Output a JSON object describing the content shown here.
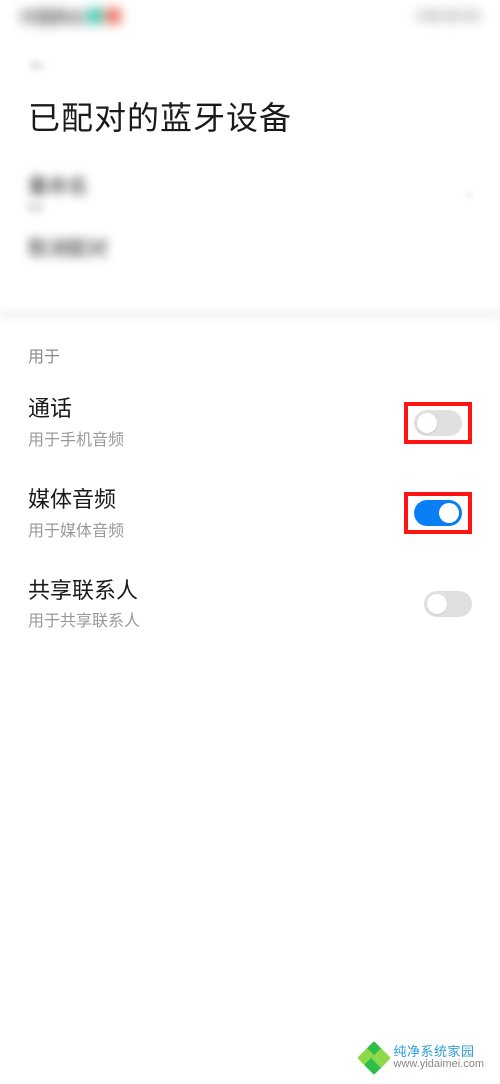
{
  "status": {
    "left": "中国移动",
    "right": "3:48 HD 4G"
  },
  "back_label": "←",
  "page_title": "已配对的蓝牙设备",
  "blurred": {
    "rename_label": "重命名",
    "rename_value": "K3",
    "unpair_label": "取消配对"
  },
  "section_header": "用于",
  "options": [
    {
      "key": "call",
      "title": "通话",
      "subtitle": "用于手机音频",
      "enabled": false,
      "highlighted": true
    },
    {
      "key": "media",
      "title": "媒体音频",
      "subtitle": "用于媒体音频",
      "enabled": true,
      "highlighted": true
    },
    {
      "key": "contacts",
      "title": "共享联系人",
      "subtitle": "用于共享联系人",
      "enabled": false,
      "highlighted": false
    }
  ],
  "watermark": {
    "line1": "纯净系统家园",
    "line2": "www.yidaimei.com"
  }
}
